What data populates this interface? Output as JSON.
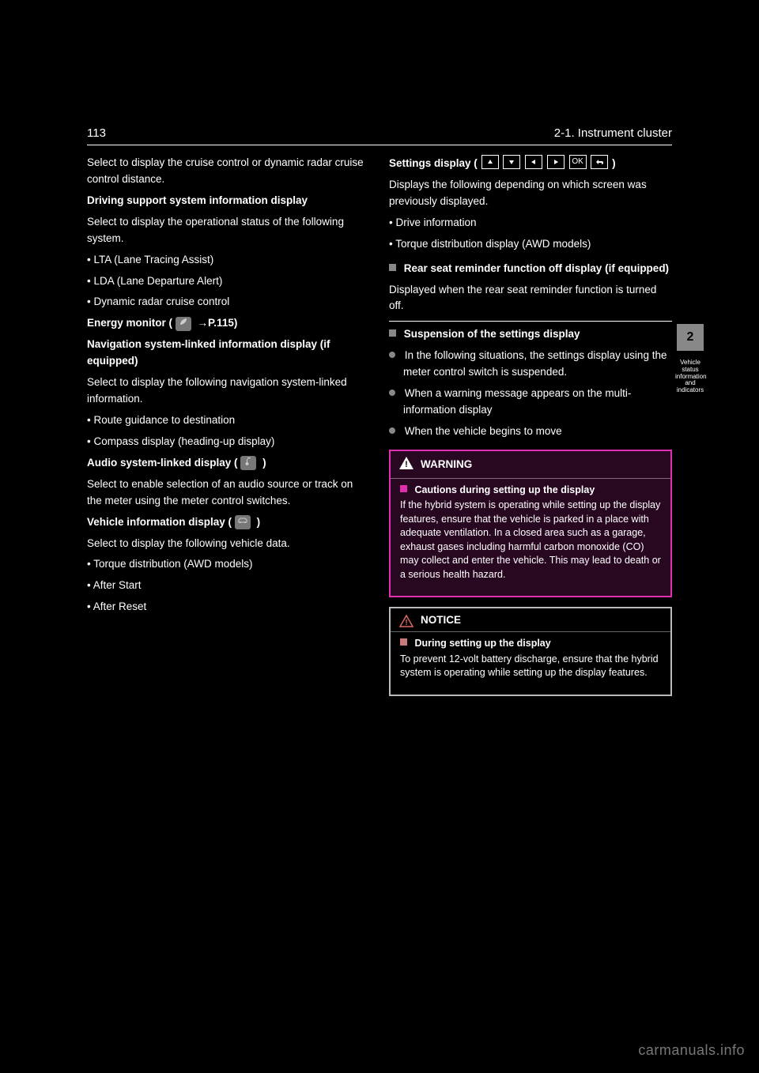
{
  "header": {
    "page": "113",
    "section": "2-1. Instrument cluster"
  },
  "sideTab": {
    "num": "2",
    "label": "Vehicle status information and indicators"
  },
  "left": {
    "p1": "Select to display the cruise control or dynamic radar cruise control distance.",
    "drivingSupportHeading": "Driving support system information display",
    "p2": "Select to display the operational status of the following system.",
    "li1": "• LTA (Lane Tracing Assist)",
    "li2": "• LDA (Lane Departure Alert)",
    "li3": "• Dynamic radar cruise control",
    "ecoHeading": "Energy monitor (",
    "ecoHeading2": "→P.115)",
    "navHeading": "Navigation system-linked information display (if equipped)",
    "p3": "Select to display the following navigation system-linked information.",
    "nli1": "• Route guidance to destination",
    "nli2": "• Compass display (heading-up display)",
    "audioHeading": "Audio system-linked display (",
    "audioHeading2": ")",
    "p4": "Select to enable selection of an audio source or track on the meter using the meter control switches.",
    "vehInfoHeading": "Vehicle information display (",
    "vehInfoHeading2": ")",
    "p5": "Select to display the following vehicle data.",
    "vli1": "• Torque distribution (AWD models)",
    "vli2": "• After Start",
    "vli3": "• After Reset"
  },
  "right": {
    "settingsHeading": "Settings display (",
    "settingsTrail": ")",
    "p1": "Displays the following depending on which screen was previously displayed.",
    "sli1": "• Drive information",
    "sli2": "• Torque distribution display (AWD models)",
    "sub1Title": "Rear seat reminder function off display (if equipped)",
    "sub1Body": "Displayed when the rear seat reminder function is turned off.",
    "sepLabel": "Suspension of the settings display",
    "b1": "In the following situations, the settings display using the meter control switch is suspended.",
    "b2": "When a warning message appears on the multi-information display",
    "b3": "When the vehicle begins to move"
  },
  "warning": {
    "label": "WARNING",
    "title": "Cautions during setting up the display",
    "body1": "If the hybrid system is operating while setting up the display features, ensure that the vehicle is parked in a place with adequate ventilation. In a closed area such as a garage, exhaust gases including harmful carbon monoxide (CO) may collect and enter the vehicle. This may lead to death or a serious health hazard."
  },
  "notice": {
    "label": "NOTICE",
    "title": "During setting up the display",
    "body1": "To prevent 12-volt battery discharge, ensure that the hybrid system is operating while setting up the display features."
  },
  "watermark": "carmanuals.info"
}
